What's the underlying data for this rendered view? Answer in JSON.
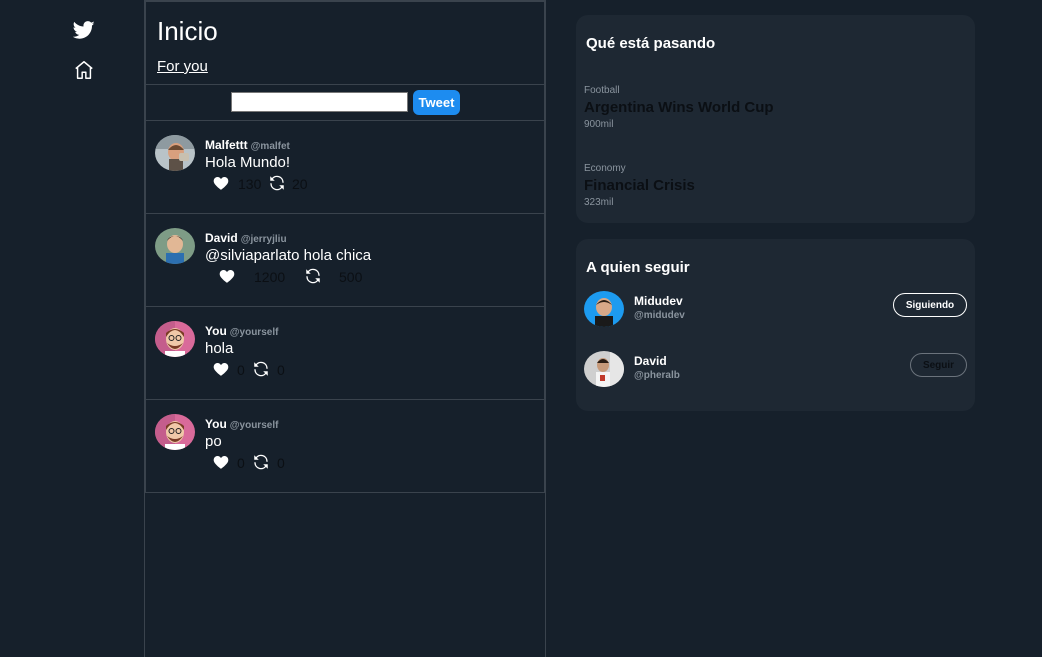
{
  "nav": {
    "logo_icon": "twitter-bird-icon",
    "home_icon": "home-icon"
  },
  "feed": {
    "title": "Inicio",
    "tab": "For you"
  },
  "composer": {
    "input_value": "",
    "button_label": "Tweet"
  },
  "tweets": [
    {
      "name": "Malfettt",
      "handle": "@malfet",
      "text": "Hola Mundo!",
      "likes": "130",
      "retweets": "20"
    },
    {
      "name": "David",
      "handle": "@jerryjliu",
      "text": "@silviaparlato hola chica",
      "likes": "1200",
      "retweets": "500"
    },
    {
      "name": "You",
      "handle": "@yourself",
      "text": "hola",
      "likes": "0",
      "retweets": "0"
    },
    {
      "name": "You",
      "handle": "@yourself",
      "text": "po",
      "likes": "0",
      "retweets": "0"
    }
  ],
  "trends": {
    "title": "Qué está pasando",
    "items": [
      {
        "category": "Football",
        "title": "Argentina Wins World Cup",
        "count": "900mil"
      },
      {
        "category": "Economy",
        "title": "Financial Crisis",
        "count": "323mil"
      }
    ]
  },
  "follow": {
    "title": "A quien seguir",
    "items": [
      {
        "name": "Midudev",
        "handle": "@midudev",
        "button": "Siguiendo"
      },
      {
        "name": "David",
        "handle": "@pheralb",
        "button": "Seguir"
      }
    ]
  },
  "colors": {
    "background": "#16202b",
    "panel": "#1e2833",
    "accent": "#1d8cf0",
    "border": "#3a434d"
  }
}
